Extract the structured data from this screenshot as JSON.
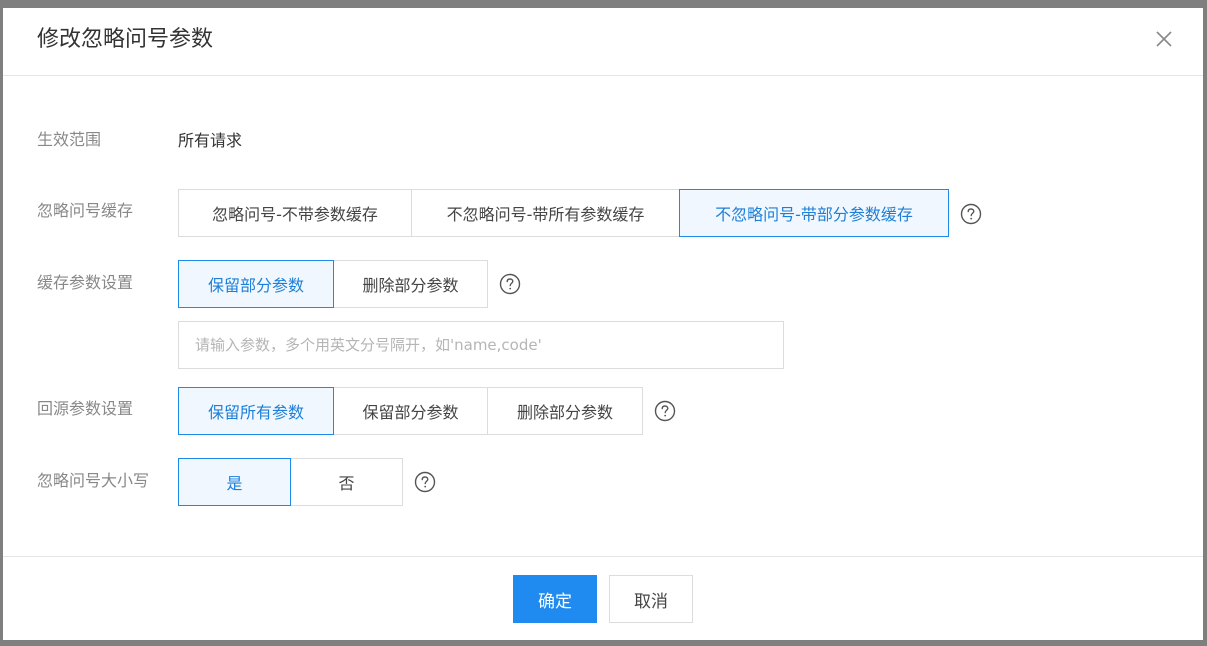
{
  "dialog": {
    "title": "修改忽略问号参数"
  },
  "scope": {
    "label": "生效范围",
    "value": "所有请求"
  },
  "ignore_cache": {
    "label": "忽略问号缓存",
    "options": [
      "忽略问号-不带参数缓存",
      "不忽略问号-带所有参数缓存",
      "不忽略问号-带部分参数缓存"
    ],
    "selected_index": 2
  },
  "cache_params": {
    "label": "缓存参数设置",
    "options": [
      "保留部分参数",
      "删除部分参数"
    ],
    "selected_index": 0,
    "input_value": "",
    "input_placeholder": "请输入参数，多个用英文分号隔开，如'name,code'"
  },
  "origin_params": {
    "label": "回源参数设置",
    "options": [
      "保留所有参数",
      "保留部分参数",
      "删除部分参数"
    ],
    "selected_index": 0
  },
  "ignore_case": {
    "label": "忽略问号大小写",
    "options": [
      "是",
      "否"
    ],
    "selected_index": 0
  },
  "footer": {
    "confirm_label": "确定",
    "cancel_label": "取消"
  },
  "colors": {
    "accent": "#1f8bf0",
    "active_bg": "#f0f7fe",
    "overlay": "#7f7f7f"
  },
  "icons": {
    "close": "close-icon",
    "help": "question-circle-icon"
  }
}
